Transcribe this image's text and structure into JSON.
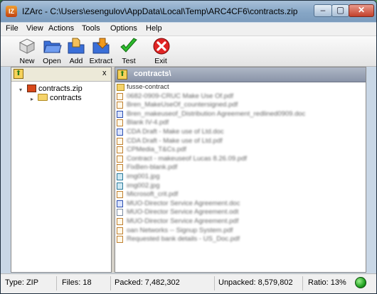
{
  "window": {
    "title": "IZArc - C:\\Users\\esengulov\\AppData\\Local\\Temp\\ARC4CF6\\contracts.zip",
    "app_icon_label": "IZ",
    "min": "–",
    "max": "▢",
    "close": "✕"
  },
  "menu": [
    "File",
    "View",
    "Actions",
    "Tools",
    "Options",
    "Help"
  ],
  "toolbar": [
    {
      "label": "New",
      "icon": "new-archive-icon"
    },
    {
      "label": "Open",
      "icon": "open-folder-icon"
    },
    {
      "label": "Add",
      "icon": "add-files-icon"
    },
    {
      "label": "Extract",
      "icon": "extract-icon"
    },
    {
      "label": "Test",
      "icon": "test-check-icon"
    },
    {
      "label": "Exit",
      "icon": "exit-icon"
    }
  ],
  "tree": {
    "close_label": "x",
    "root": "contracts.zip",
    "child": "contracts"
  },
  "path": "contracts\\",
  "files": [
    {
      "name": "fusse-contract",
      "type": "fold"
    },
    {
      "name": "0682-0909-CRUC Make Use Of.pdf",
      "type": "pdf"
    },
    {
      "name": "Bren_MakeUseOf_countersigned.pdf",
      "type": "pdf"
    },
    {
      "name": "Bren_makeuseof_Distribution Agreement_redlined0909.doc",
      "type": "doc"
    },
    {
      "name": "Blank IV-4.pdf",
      "type": "pdf"
    },
    {
      "name": "CDA Draft - Make use of Ltd.doc",
      "type": "doc"
    },
    {
      "name": "CDA Draft - Make use of Ltd.pdf",
      "type": "pdf"
    },
    {
      "name": "CPMedia_T&Cs.pdf",
      "type": "pdf"
    },
    {
      "name": "Contract - makeuseof Lucas 8.26.09.pdf",
      "type": "pdf"
    },
    {
      "name": "FixBen-blank.pdf",
      "type": "pdf"
    },
    {
      "name": "img001.jpg",
      "type": "jpg"
    },
    {
      "name": "img002.jpg",
      "type": "jpg"
    },
    {
      "name": "Microsoft_crit.pdf",
      "type": "pdf"
    },
    {
      "name": "MUO-Director Service Agreement.doc",
      "type": "doc"
    },
    {
      "name": "MUO-Director Service Agreement.odt",
      "type": "odt"
    },
    {
      "name": "MUO-Director Service Agreement.pdf",
      "type": "pdf"
    },
    {
      "name": "oan Networks -- Signup System.pdf",
      "type": "pdf"
    },
    {
      "name": "Requested bank details - US_Doc.pdf",
      "type": "pdf"
    }
  ],
  "status": {
    "type": "Type: ZIP",
    "files": "Files: 18",
    "packed": "Packed: 7,482,302",
    "unpacked": "Unpacked: 8,579,802",
    "ratio": "Ratio: 13%"
  }
}
